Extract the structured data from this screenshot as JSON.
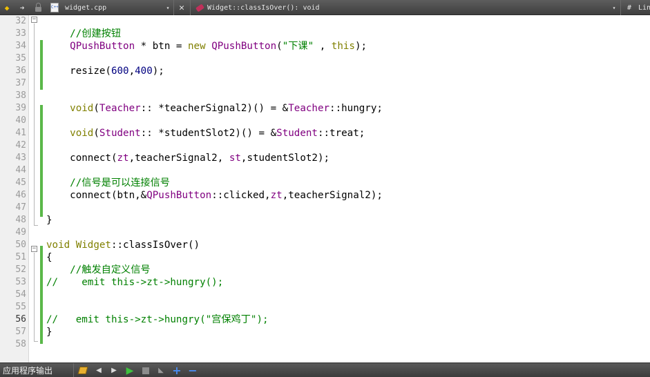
{
  "toolbar": {
    "back_icon": "◆",
    "forward_icon": "➜",
    "file_icon_text": "C++",
    "file_name": "widget.cpp",
    "close_icon": "✕",
    "dropdown_icon": "▾",
    "function_name": "Widget::classIsOver(): void",
    "hash_label": "#",
    "line_label": "Lin"
  },
  "editor": {
    "lines": [
      {
        "num": "32",
        "html": ""
      },
      {
        "num": "33",
        "html": "    <span class=\"cmt\">//创建按钮</span>"
      },
      {
        "num": "34",
        "html": "    <span class=\"typ\">QPushButton</span> * btn = <span class=\"kw\">new</span> <span class=\"typ\">QPushButton</span>(<span class=\"str\">\"下课\"</span> , <span class=\"kw\">this</span>);"
      },
      {
        "num": "35",
        "html": ""
      },
      {
        "num": "36",
        "html": "    resize(<span class=\"num\">600</span>,<span class=\"num\">400</span>);"
      },
      {
        "num": "37",
        "html": ""
      },
      {
        "num": "38",
        "html": ""
      },
      {
        "num": "39",
        "html": "    <span class=\"kw\">void</span>(<span class=\"typ\">Teacher</span>:: *teacherSignal2)() = &amp;<span class=\"typ\">Teacher</span>::hungry;"
      },
      {
        "num": "40",
        "html": ""
      },
      {
        "num": "41",
        "html": "    <span class=\"kw\">void</span>(<span class=\"typ\">Student</span>:: *studentSlot2)() = &amp;<span class=\"typ\">Student</span>::treat;"
      },
      {
        "num": "42",
        "html": ""
      },
      {
        "num": "43",
        "html": "    connect(<span class=\"typ\">zt</span>,teacherSignal2, <span class=\"typ\">st</span>,studentSlot2);"
      },
      {
        "num": "44",
        "html": ""
      },
      {
        "num": "45",
        "html": "    <span class=\"cmt\">//信号是可以连接信号</span>"
      },
      {
        "num": "46",
        "html": "    connect(btn,&amp;<span class=\"typ\">QPushButton</span>::clicked,<span class=\"typ\">zt</span>,teacherSignal2);"
      },
      {
        "num": "47",
        "html": ""
      },
      {
        "num": "48",
        "html": "}"
      },
      {
        "num": "49",
        "html": ""
      },
      {
        "num": "50",
        "html": "<span class=\"kw\">void</span> <span class=\"kw\">Widget</span>::classIsOver()"
      },
      {
        "num": "51",
        "html": "{"
      },
      {
        "num": "52",
        "html": "    <span class=\"cmt\">//触发自定义信号</span>"
      },
      {
        "num": "53",
        "html": "<span class=\"cmt\">//    emit this-&gt;zt-&gt;hungry();</span>"
      },
      {
        "num": "54",
        "html": ""
      },
      {
        "num": "55",
        "html": ""
      },
      {
        "num": "56",
        "html": "<span class=\"cmt\">//   emit this-&gt;zt-&gt;hungry(\"宫保鸡丁\");</span>"
      },
      {
        "num": "57",
        "html": "}"
      },
      {
        "num": "58",
        "html": ""
      }
    ],
    "current_line": "56",
    "fold_markers": [
      "32",
      "50"
    ]
  },
  "bottombar": {
    "output_label": "应用程序输出",
    "clear_icon": "clear-output-icon",
    "prev_icon": "◀",
    "next_icon": "▶",
    "run_icon": "▶",
    "attach_icon": "◣",
    "plus_icon": "+",
    "minus_icon": "−"
  }
}
